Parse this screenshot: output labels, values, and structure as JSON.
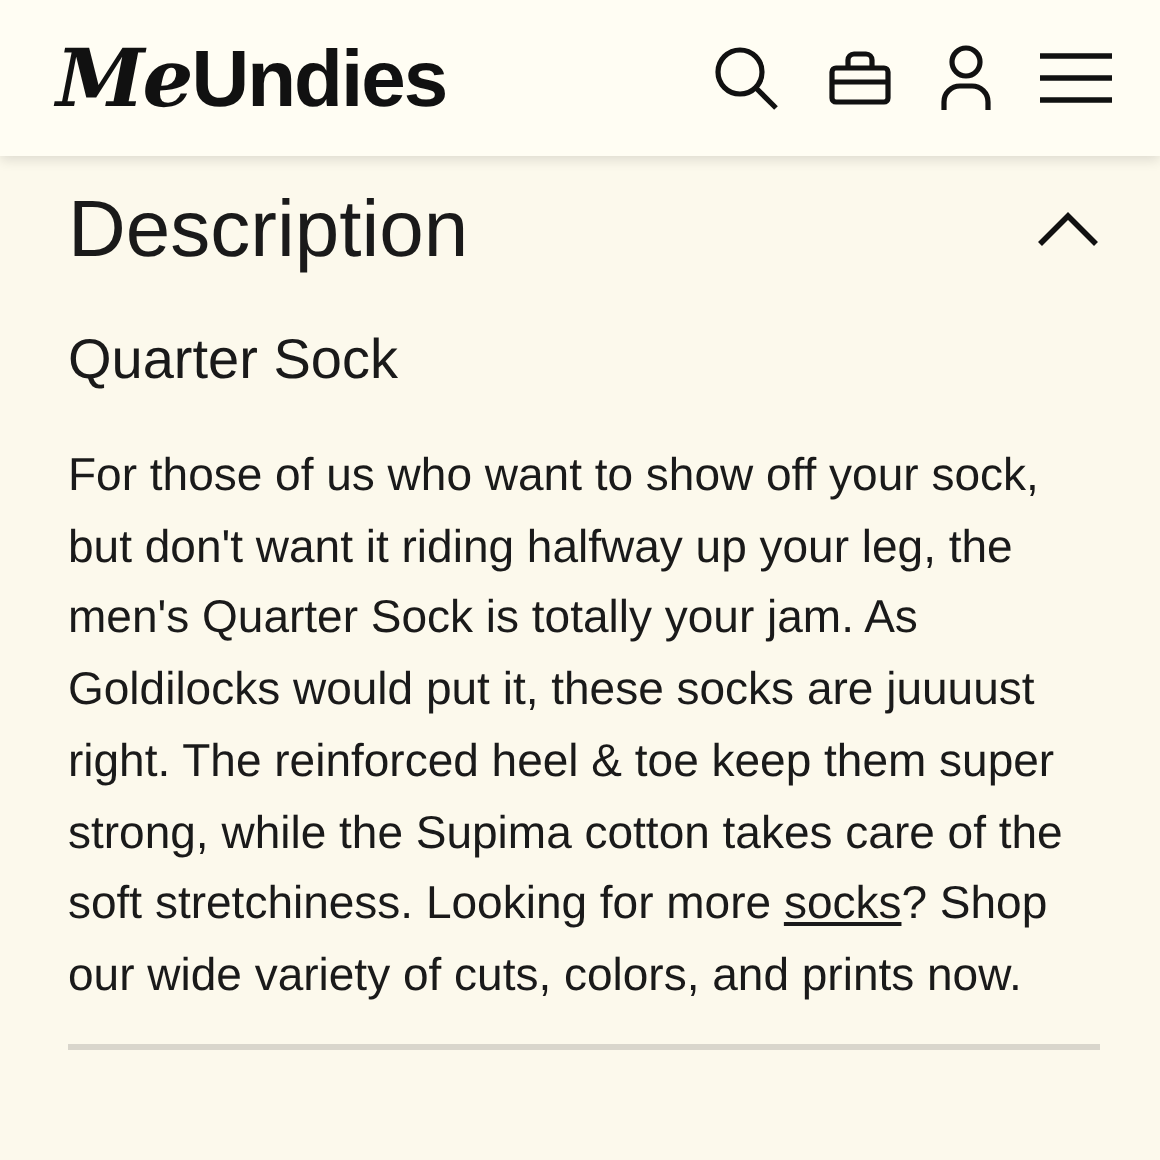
{
  "header": {
    "logo_script": "Me",
    "logo_bold": "Undies"
  },
  "section": {
    "title": "Description",
    "expanded": true,
    "subtitle": "Quarter Sock",
    "text_before": "For those of us who want to show off your sock, but don't want it riding halfway up your leg, the men's Quarter Sock is totally your jam. As Goldilocks would put it, these socks are juuuust right. The reinforced heel & toe keep them super strong, while the Supima cotton takes care of the soft stretchiness. Looking for more ",
    "link": "socks",
    "text_after": "? Shop our wide variety of cuts, colors, and prints now."
  }
}
